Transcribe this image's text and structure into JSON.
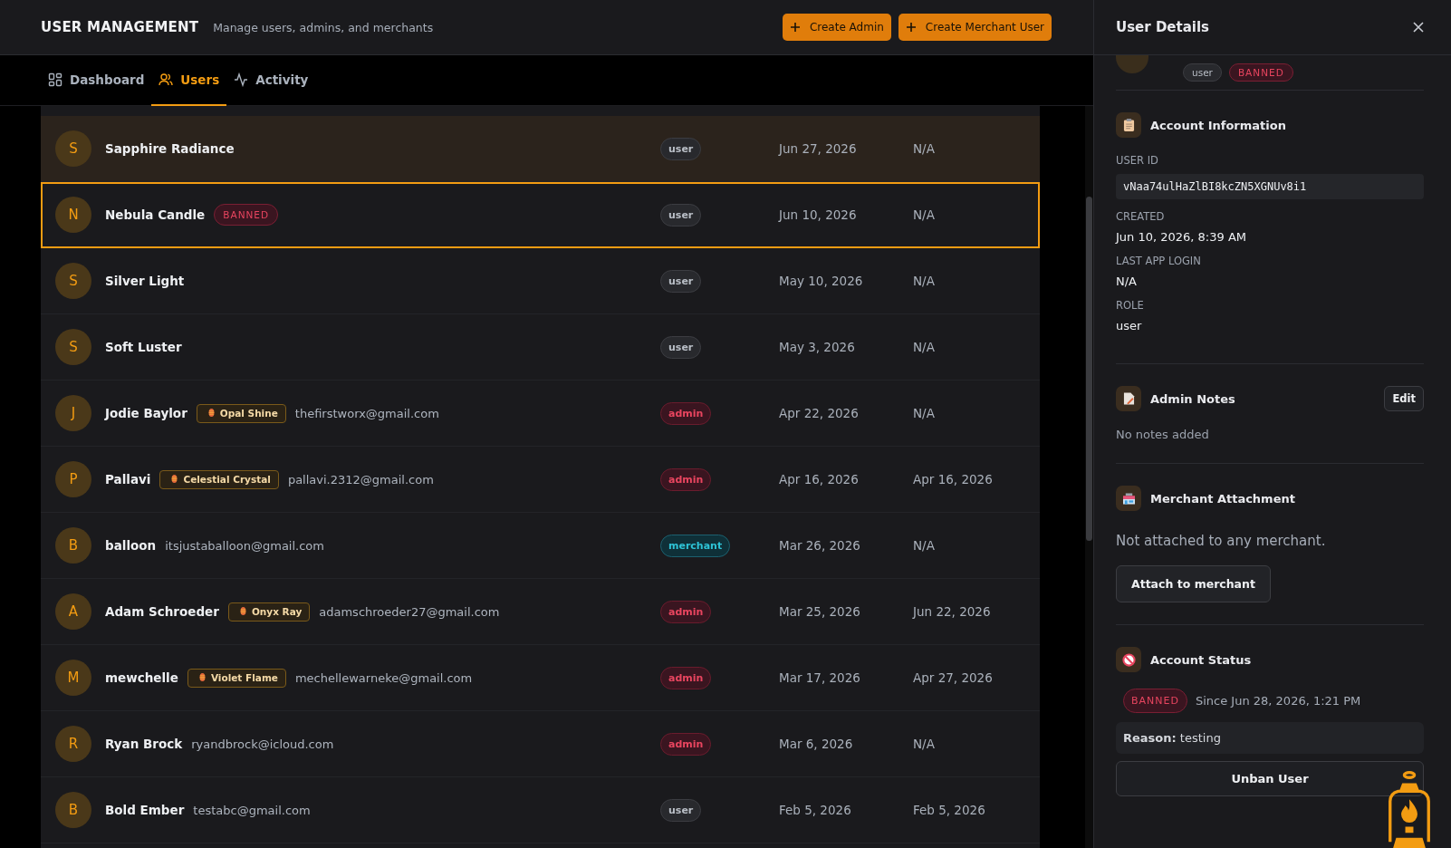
{
  "header": {
    "title": "USER MANAGEMENT",
    "subtitle": "Manage users, admins, and merchants",
    "buttons": [
      {
        "label": "Create Admin"
      },
      {
        "label": "Create Merchant User"
      }
    ]
  },
  "tabs": [
    {
      "label": "Dashboard",
      "selected": false
    },
    {
      "label": "Users",
      "selected": true
    },
    {
      "label": "Activity",
      "selected": false
    }
  ],
  "users": [
    {
      "initial": "S",
      "name": "Sapphire Radiance",
      "role": "user",
      "kind": "plain",
      "created": "Jun 27, 2026",
      "last_login": "N/A",
      "hovered": true,
      "selected": false
    },
    {
      "initial": "N",
      "name": "Nebula Candle",
      "status": "BANNED",
      "role": "user",
      "kind": "plain",
      "created": "Jun 10, 2026",
      "last_login": "N/A",
      "hovered": false,
      "selected": true
    },
    {
      "initial": "S",
      "name": "Silver Light",
      "role": "user",
      "kind": "plain",
      "created": "May 10, 2026",
      "last_login": "N/A",
      "hovered": false,
      "selected": false
    },
    {
      "initial": "S",
      "name": "Soft Luster",
      "role": "user",
      "kind": "plain",
      "created": "May 3, 2026",
      "last_login": "N/A",
      "hovered": false,
      "selected": false
    },
    {
      "initial": "J",
      "name": "Jodie Baylor",
      "tag": "Opal Shine",
      "email": "thefirstworx@gmail.com",
      "role": "admin",
      "kind": "alert",
      "created": "Apr 22, 2026",
      "last_login": "N/A",
      "hovered": false,
      "selected": false
    },
    {
      "initial": "P",
      "name": "Pallavi",
      "tag": "Celestial Crystal",
      "email": "pallavi.2312@gmail.com",
      "role": "admin",
      "kind": "alert",
      "created": "Apr 16, 2026",
      "last_login": "Apr 16, 2026",
      "hovered": false,
      "selected": false
    },
    {
      "initial": "B",
      "name": "balloon",
      "email": "itsjustaballoon@gmail.com",
      "role": "merchant",
      "kind": "accent",
      "created": "Mar 26, 2026",
      "last_login": "N/A",
      "hovered": false,
      "selected": false
    },
    {
      "initial": "A",
      "name": "Adam Schroeder",
      "tag": "Onyx Ray",
      "email": "adamschroeder27@gmail.com",
      "role": "admin",
      "kind": "alert",
      "created": "Mar 25, 2026",
      "last_login": "Jun 22, 2026",
      "hovered": false,
      "selected": false
    },
    {
      "initial": "M",
      "name": "mewchelle",
      "tag": "Violet Flame",
      "email": "mechellewarneke@gmail.com",
      "role": "admin",
      "kind": "alert",
      "created": "Mar 17, 2026",
      "last_login": "Apr 27, 2026",
      "hovered": false,
      "selected": false
    },
    {
      "initial": "R",
      "name": "Ryan Brock",
      "email": "ryandbrock@icloud.com",
      "role": "admin",
      "kind": "alert",
      "created": "Mar 6, 2026",
      "last_login": "N/A",
      "hovered": false,
      "selected": false
    },
    {
      "initial": "B",
      "name": "Bold Ember",
      "email": "testabc@gmail.com",
      "role": "user",
      "kind": "plain",
      "created": "Feb 5, 2026",
      "last_login": "Feb 5, 2026",
      "hovered": false,
      "selected": false
    }
  ],
  "details": {
    "title": "User Details",
    "profile_badges": [
      {
        "label": "user",
        "kind": "role"
      },
      {
        "label": "BANNED",
        "kind": "banned"
      }
    ],
    "account": {
      "title": "Account Information",
      "fields": [
        {
          "label": "USER ID",
          "value": "vNaa74ulHaZlBI8kcZN5XGNUv8i1",
          "kind": "code"
        },
        {
          "label": "CREATED",
          "value": "Jun 10, 2026, 8:39 AM",
          "kind": "text"
        },
        {
          "label": "LAST APP LOGIN",
          "value": "N/A",
          "kind": "text"
        },
        {
          "label": "ROLE",
          "value": "user",
          "kind": "text"
        }
      ]
    },
    "notes": {
      "title": "Admin Notes",
      "edit": "Edit",
      "empty": "No notes added"
    },
    "merchant": {
      "title": "Merchant Attachment",
      "text": "Not attached to any merchant.",
      "button": "Attach to merchant"
    },
    "status": {
      "title": "Account Status",
      "badge": "BANNED",
      "since": "Since Jun 28, 2026, 1:21 PM",
      "reason": "**Reason:** testing",
      "button": "Unban User"
    }
  }
}
